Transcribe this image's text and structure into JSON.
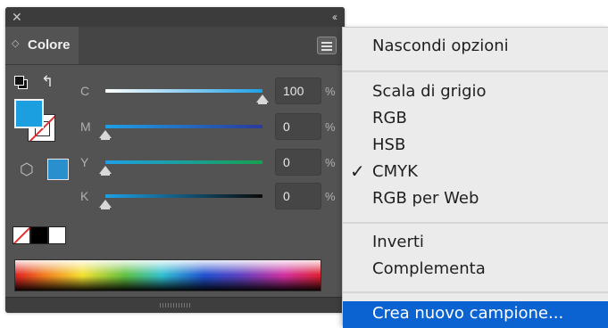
{
  "panel": {
    "title": "Colore",
    "close_glyph": "✕",
    "collapse_glyph": "‹‹",
    "tab_arrows_glyph": "◇",
    "swap_glyph": "↰",
    "cube_glyph": "⬡",
    "fill_color": "#1b9fe0",
    "gamut_color": "#2a8fcd",
    "sliders": [
      {
        "label": "C",
        "value": "100",
        "unit": "%",
        "level": 1.0
      },
      {
        "label": "M",
        "value": "0",
        "unit": "%",
        "level": 0.0
      },
      {
        "label": "Y",
        "value": "0",
        "unit": "%",
        "level": 0.0
      },
      {
        "label": "K",
        "value": "0",
        "unit": "%",
        "level": 0.0
      }
    ]
  },
  "menu": {
    "items": [
      {
        "label": "Nascondi opzioni",
        "checked": false
      },
      {
        "label": "Scala di grigio",
        "checked": false
      },
      {
        "label": "RGB",
        "checked": false
      },
      {
        "label": "HSB",
        "checked": false
      },
      {
        "label": "CMYK",
        "checked": true
      },
      {
        "label": "RGB per Web",
        "checked": false
      },
      {
        "label": "Inverti",
        "checked": false
      },
      {
        "label": "Complementa",
        "checked": false
      },
      {
        "label": "Crea nuovo campione...",
        "checked": false,
        "highlighted": true
      }
    ],
    "check_glyph": "✓",
    "highlight_color": "#0a63d1"
  }
}
